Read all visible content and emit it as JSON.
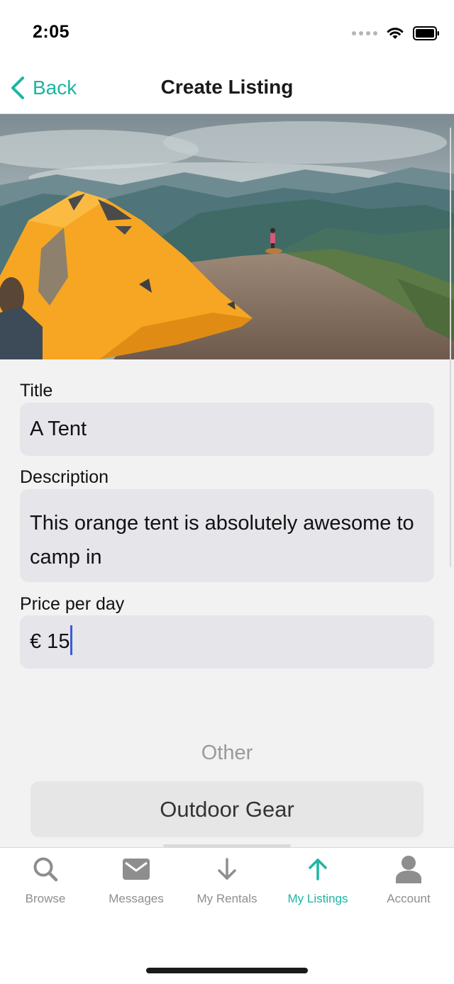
{
  "status_bar": {
    "time": "2:05"
  },
  "nav": {
    "back_label": "Back",
    "title": "Create Listing"
  },
  "form": {
    "title_label": "Title",
    "title_value": "A Tent",
    "description_label": "Description",
    "description_value": "This orange tent is absolutely awesome to camp in",
    "price_label": "Price per day",
    "price_value": "€ 15"
  },
  "category_picker": {
    "other_option": "Other",
    "selected_option": "Outdoor Gear"
  },
  "tab_bar": {
    "tabs": [
      {
        "label": "Browse",
        "icon": "search-icon"
      },
      {
        "label": "Messages",
        "icon": "envelope-icon"
      },
      {
        "label": "My Rentals",
        "icon": "arrow-down-icon"
      },
      {
        "label": "My Listings",
        "icon": "arrow-up-icon",
        "active": true
      },
      {
        "label": "Account",
        "icon": "person-icon"
      }
    ]
  },
  "colors": {
    "accent": "#1cb5a3",
    "inactive": "#8e8e8e",
    "field_background": "#e5e5ea",
    "tent_orange": "#f6a623"
  }
}
